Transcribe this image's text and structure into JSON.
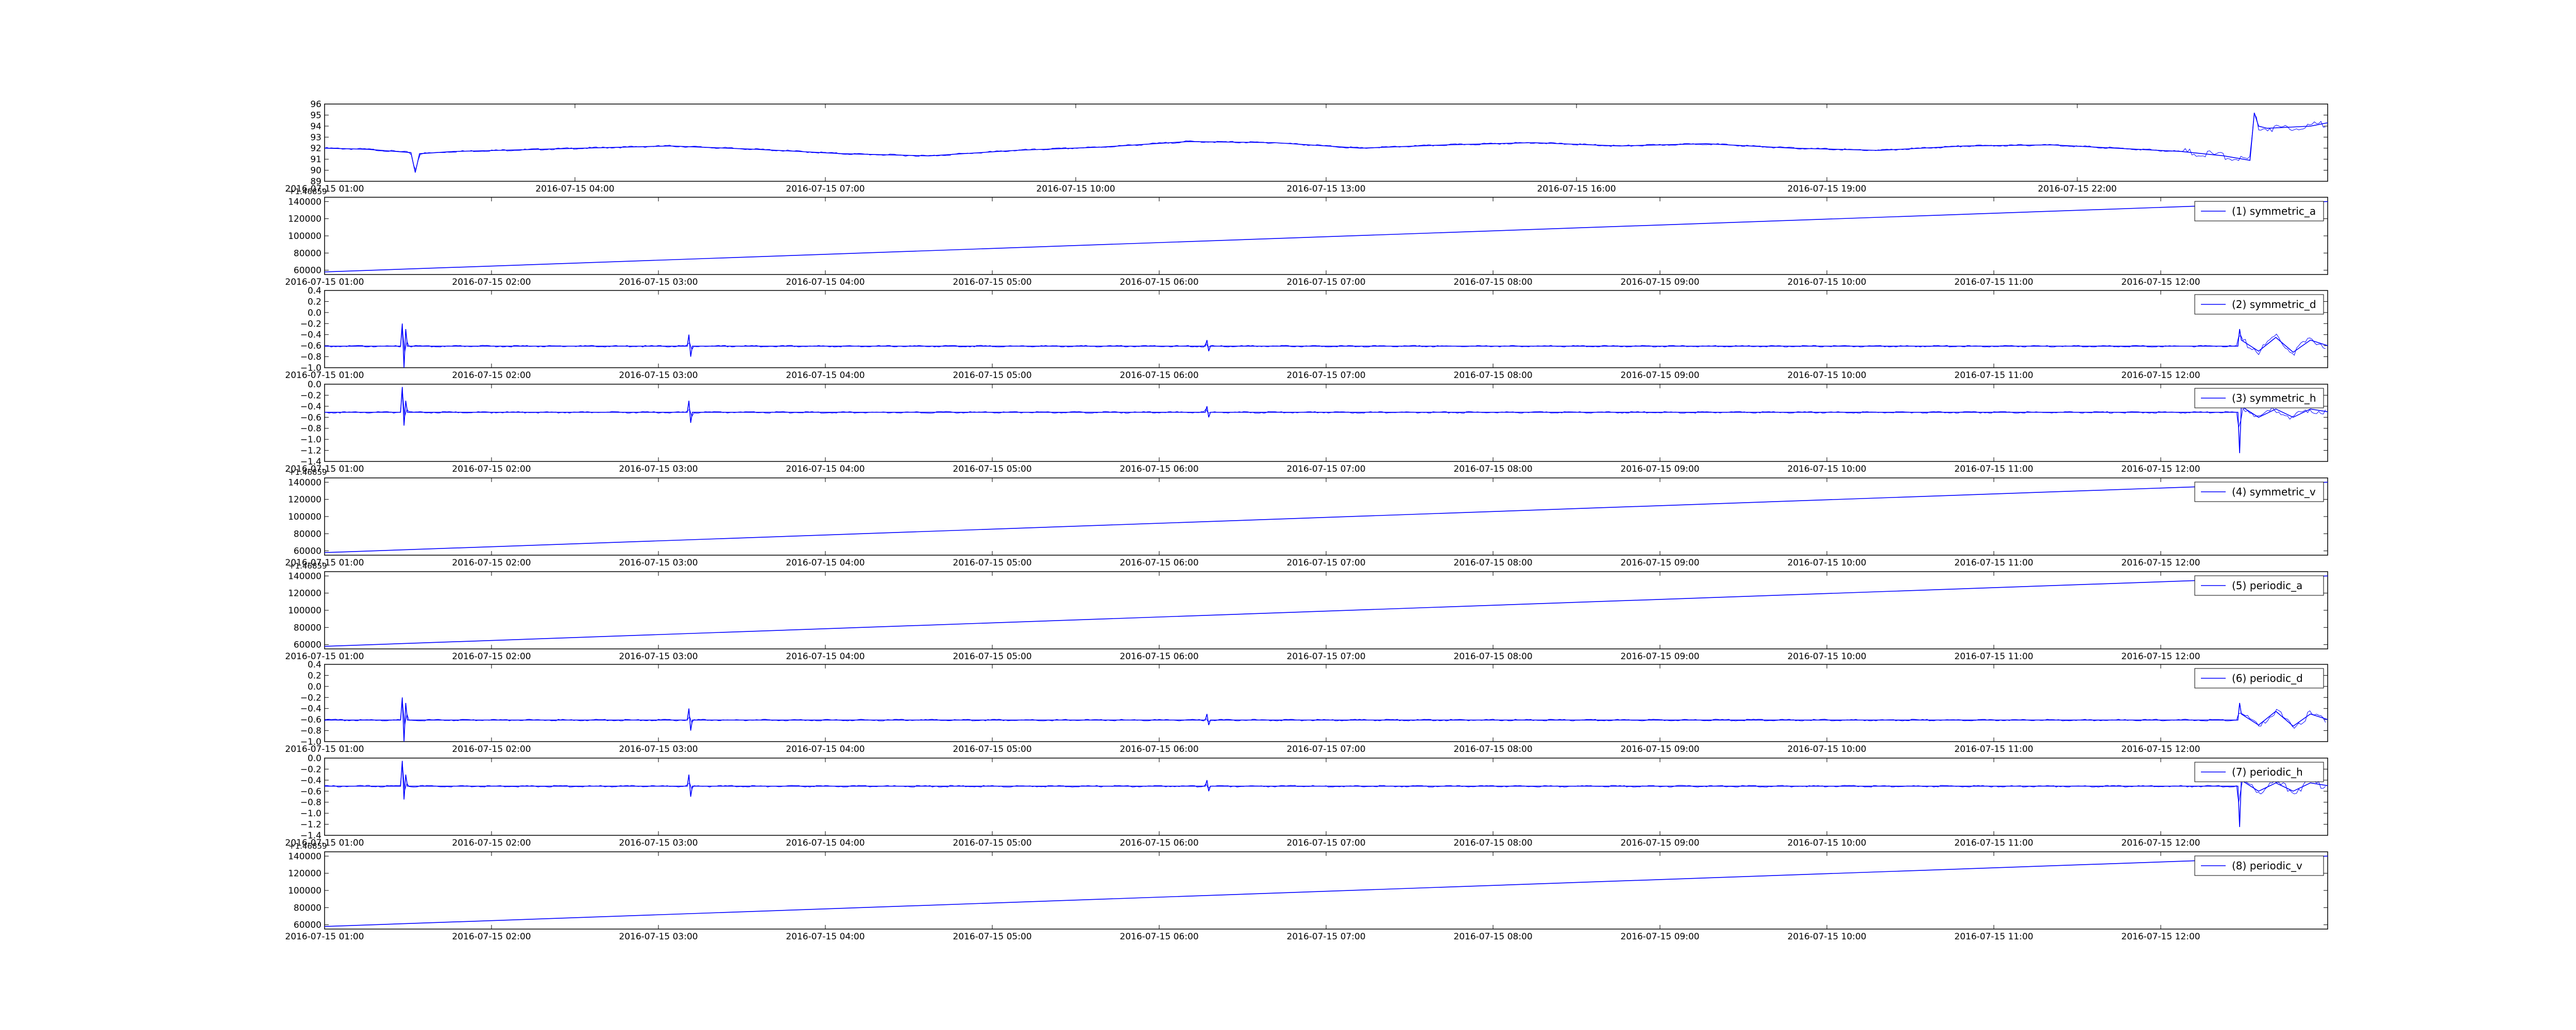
{
  "chart_data": [
    {
      "type": "line",
      "title": "",
      "xlabel": "",
      "ylabel": "",
      "x_ticks": [
        "2016-07-15 01:00",
        "2016-07-15 04:00",
        "2016-07-15 07:00",
        "2016-07-15 10:00",
        "2016-07-15 13:00",
        "2016-07-15 16:00",
        "2016-07-15 19:00",
        "2016-07-15 22:00"
      ],
      "xlim": [
        0,
        23.2
      ],
      "y_ticks": [
        "89",
        "90",
        "91",
        "92",
        "93",
        "94",
        "95",
        "96"
      ],
      "ylim": [
        89,
        96
      ],
      "offset_text": "",
      "legend": "",
      "grid": false,
      "color": "#0000ff",
      "series": [
        {
          "x": [
            0,
            0.5,
            1.0,
            1.05,
            1.1,
            1.5,
            2,
            3,
            4,
            5,
            6,
            7,
            8,
            9,
            10,
            11,
            12,
            13,
            14,
            15,
            16,
            17,
            18,
            19,
            20,
            21,
            21.5,
            22,
            22.3,
            22.35,
            22.4,
            22.5,
            23,
            23.2
          ],
          "y": [
            92.0,
            91.9,
            91.6,
            89.8,
            91.5,
            91.7,
            91.8,
            92.0,
            92.2,
            91.9,
            91.5,
            91.3,
            91.8,
            92.1,
            92.6,
            92.5,
            92.0,
            92.3,
            92.5,
            92.2,
            92.4,
            92.0,
            91.8,
            92.2,
            92.3,
            91.9,
            91.7,
            91.3,
            90.9,
            95.2,
            94.0,
            93.8,
            94.0,
            94.3
          ]
        }
      ]
    },
    {
      "type": "line",
      "title": "",
      "xlabel": "",
      "ylabel": "",
      "x_ticks": [
        "2016-07-15 01:00",
        "2016-07-15 02:00",
        "2016-07-15 03:00",
        "2016-07-15 04:00",
        "2016-07-15 05:00",
        "2016-07-15 06:00",
        "2016-07-15 07:00",
        "2016-07-15 08:00",
        "2016-07-15 09:00",
        "2016-07-15 10:00",
        "2016-07-15 11:00",
        "2016-07-15 12:00"
      ],
      "xlim": [
        0,
        11.6
      ],
      "y_ticks": [
        "60000",
        "80000",
        "100000",
        "120000",
        "140000"
      ],
      "ylim": [
        55000,
        145000
      ],
      "offset_text": "+1.46859",
      "legend": "top-right",
      "grid": false,
      "color": "#0000ff",
      "series": [
        {
          "name": "(1) symmetric_a",
          "x": [
            0,
            11.6
          ],
          "y": [
            58000,
            140000
          ]
        }
      ]
    },
    {
      "type": "line",
      "title": "",
      "xlabel": "",
      "ylabel": "",
      "x_ticks": [
        "2016-07-15 01:00",
        "2016-07-15 02:00",
        "2016-07-15 03:00",
        "2016-07-15 04:00",
        "2016-07-15 05:00",
        "2016-07-15 06:00",
        "2016-07-15 07:00",
        "2016-07-15 08:00",
        "2016-07-15 09:00",
        "2016-07-15 10:00",
        "2016-07-15 11:00",
        "2016-07-15 12:00"
      ],
      "xlim": [
        0,
        11.6
      ],
      "y_ticks": [
        "−1.0",
        "−0.8",
        "−0.6",
        "−0.4",
        "−0.2",
        "0.0",
        "0.2",
        "0.4"
      ],
      "ylim": [
        -1.0,
        0.4
      ],
      "offset_text": "",
      "legend": "top-right",
      "grid": false,
      "color": "#0000ff",
      "series": [
        {
          "name": "(2) symmetric_d",
          "x": [
            0,
            0.44,
            0.45,
            0.46,
            0.47,
            0.48,
            1.5,
            2.1,
            2.11,
            2.12,
            2.13,
            2.14,
            4.5,
            5.1,
            5.11,
            5.12,
            5.13,
            11.08,
            11.09,
            11.1,
            11.2,
            11.3,
            11.4,
            11.5,
            11.6
          ],
          "y": [
            -0.61,
            -0.61,
            -0.2,
            -1.0,
            -0.3,
            -0.61,
            -0.61,
            -0.61,
            -0.4,
            -0.8,
            -0.61,
            -0.61,
            -0.61,
            -0.61,
            -0.5,
            -0.7,
            -0.61,
            -0.61,
            -0.3,
            -0.5,
            -0.7,
            -0.45,
            -0.72,
            -0.5,
            -0.6
          ]
        }
      ]
    },
    {
      "type": "line",
      "title": "",
      "xlabel": "",
      "ylabel": "",
      "x_ticks": [
        "2016-07-15 01:00",
        "2016-07-15 02:00",
        "2016-07-15 03:00",
        "2016-07-15 04:00",
        "2016-07-15 05:00",
        "2016-07-15 06:00",
        "2016-07-15 07:00",
        "2016-07-15 08:00",
        "2016-07-15 09:00",
        "2016-07-15 10:00",
        "2016-07-15 11:00",
        "2016-07-15 12:00"
      ],
      "xlim": [
        0,
        11.6
      ],
      "y_ticks": [
        "−1.4",
        "−1.2",
        "−1.0",
        "−0.8",
        "−0.6",
        "−0.4",
        "−0.2",
        "0.0"
      ],
      "ylim": [
        -1.4,
        0.0
      ],
      "offset_text": "",
      "legend": "top-right",
      "grid": false,
      "color": "#0000ff",
      "series": [
        {
          "name": "(3) symmetric_h",
          "x": [
            0,
            0.44,
            0.45,
            0.46,
            0.47,
            0.48,
            1.5,
            2.1,
            2.11,
            2.12,
            2.13,
            2.14,
            4.5,
            5.1,
            5.11,
            5.12,
            5.13,
            11.08,
            11.09,
            11.1,
            11.2,
            11.3,
            11.4,
            11.5,
            11.6
          ],
          "y": [
            -0.51,
            -0.51,
            -0.05,
            -0.75,
            -0.3,
            -0.51,
            -0.51,
            -0.51,
            -0.3,
            -0.7,
            -0.51,
            -0.51,
            -0.51,
            -0.51,
            -0.4,
            -0.6,
            -0.51,
            -0.51,
            -1.25,
            -0.4,
            -0.6,
            -0.45,
            -0.6,
            -0.45,
            -0.5
          ]
        }
      ]
    },
    {
      "type": "line",
      "title": "",
      "xlabel": "",
      "ylabel": "",
      "x_ticks": [
        "2016-07-15 01:00",
        "2016-07-15 02:00",
        "2016-07-15 03:00",
        "2016-07-15 04:00",
        "2016-07-15 05:00",
        "2016-07-15 06:00",
        "2016-07-15 07:00",
        "2016-07-15 08:00",
        "2016-07-15 09:00",
        "2016-07-15 10:00",
        "2016-07-15 11:00",
        "2016-07-15 12:00"
      ],
      "xlim": [
        0,
        11.6
      ],
      "y_ticks": [
        "60000",
        "80000",
        "100000",
        "120000",
        "140000"
      ],
      "ylim": [
        55000,
        145000
      ],
      "offset_text": "+1.46859",
      "legend": "top-right",
      "grid": false,
      "color": "#0000ff",
      "series": [
        {
          "name": "(4) symmetric_v",
          "x": [
            0,
            11.6
          ],
          "y": [
            58000,
            140000
          ]
        }
      ]
    },
    {
      "type": "line",
      "title": "",
      "xlabel": "",
      "ylabel": "",
      "x_ticks": [
        "2016-07-15 01:00",
        "2016-07-15 02:00",
        "2016-07-15 03:00",
        "2016-07-15 04:00",
        "2016-07-15 05:00",
        "2016-07-15 06:00",
        "2016-07-15 07:00",
        "2016-07-15 08:00",
        "2016-07-15 09:00",
        "2016-07-15 10:00",
        "2016-07-15 11:00",
        "2016-07-15 12:00"
      ],
      "xlim": [
        0,
        11.6
      ],
      "y_ticks": [
        "60000",
        "80000",
        "100000",
        "120000",
        "140000"
      ],
      "ylim": [
        55000,
        145000
      ],
      "offset_text": "+1.46859",
      "legend": "top-right",
      "grid": false,
      "color": "#0000ff",
      "series": [
        {
          "name": "(5) periodic_a",
          "x": [
            0,
            11.6
          ],
          "y": [
            58000,
            140000
          ]
        }
      ]
    },
    {
      "type": "line",
      "title": "",
      "xlabel": "",
      "ylabel": "",
      "x_ticks": [
        "2016-07-15 01:00",
        "2016-07-15 02:00",
        "2016-07-15 03:00",
        "2016-07-15 04:00",
        "2016-07-15 05:00",
        "2016-07-15 06:00",
        "2016-07-15 07:00",
        "2016-07-15 08:00",
        "2016-07-15 09:00",
        "2016-07-15 10:00",
        "2016-07-15 11:00",
        "2016-07-15 12:00"
      ],
      "xlim": [
        0,
        11.6
      ],
      "y_ticks": [
        "−1.0",
        "−0.8",
        "−0.6",
        "−0.4",
        "−0.2",
        "0.0",
        "0.2",
        "0.4"
      ],
      "ylim": [
        -1.0,
        0.4
      ],
      "offset_text": "",
      "legend": "top-right",
      "grid": false,
      "color": "#0000ff",
      "series": [
        {
          "name": "(6) periodic_d",
          "x": [
            0,
            0.44,
            0.45,
            0.46,
            0.47,
            0.48,
            1.5,
            2.1,
            2.11,
            2.12,
            2.13,
            2.14,
            4.5,
            5.1,
            5.11,
            5.12,
            5.13,
            11.08,
            11.09,
            11.1,
            11.2,
            11.3,
            11.4,
            11.5,
            11.6
          ],
          "y": [
            -0.61,
            -0.61,
            -0.2,
            -1.0,
            -0.3,
            -0.61,
            -0.61,
            -0.61,
            -0.4,
            -0.8,
            -0.61,
            -0.61,
            -0.61,
            -0.61,
            -0.5,
            -0.7,
            -0.61,
            -0.61,
            -0.3,
            -0.5,
            -0.7,
            -0.45,
            -0.72,
            -0.5,
            -0.6
          ]
        }
      ]
    },
    {
      "type": "line",
      "title": "",
      "xlabel": "",
      "ylabel": "",
      "x_ticks": [
        "2016-07-15 01:00",
        "2016-07-15 02:00",
        "2016-07-15 03:00",
        "2016-07-15 04:00",
        "2016-07-15 05:00",
        "2016-07-15 06:00",
        "2016-07-15 07:00",
        "2016-07-15 08:00",
        "2016-07-15 09:00",
        "2016-07-15 10:00",
        "2016-07-15 11:00",
        "2016-07-15 12:00"
      ],
      "xlim": [
        0,
        11.6
      ],
      "y_ticks": [
        "−1.4",
        "−1.2",
        "−1.0",
        "−0.8",
        "−0.6",
        "−0.4",
        "−0.2",
        "0.0"
      ],
      "ylim": [
        -1.4,
        0.0
      ],
      "offset_text": "",
      "legend": "top-right",
      "grid": false,
      "color": "#0000ff",
      "series": [
        {
          "name": "(7) periodic_h",
          "x": [
            0,
            0.44,
            0.45,
            0.46,
            0.47,
            0.48,
            1.5,
            2.1,
            2.11,
            2.12,
            2.13,
            2.14,
            4.5,
            5.1,
            5.11,
            5.12,
            5.13,
            11.08,
            11.09,
            11.1,
            11.2,
            11.3,
            11.4,
            11.5,
            11.6
          ],
          "y": [
            -0.51,
            -0.51,
            -0.05,
            -0.75,
            -0.3,
            -0.51,
            -0.51,
            -0.51,
            -0.3,
            -0.7,
            -0.51,
            -0.51,
            -0.51,
            -0.51,
            -0.4,
            -0.6,
            -0.51,
            -0.51,
            -1.25,
            -0.4,
            -0.6,
            -0.45,
            -0.6,
            -0.45,
            -0.5
          ]
        }
      ]
    },
    {
      "type": "line",
      "title": "",
      "xlabel": "",
      "ylabel": "",
      "x_ticks": [
        "2016-07-15 01:00",
        "2016-07-15 02:00",
        "2016-07-15 03:00",
        "2016-07-15 04:00",
        "2016-07-15 05:00",
        "2016-07-15 06:00",
        "2016-07-15 07:00",
        "2016-07-15 08:00",
        "2016-07-15 09:00",
        "2016-07-15 10:00",
        "2016-07-15 11:00",
        "2016-07-15 12:00"
      ],
      "xlim": [
        0,
        11.6
      ],
      "y_ticks": [
        "60000",
        "80000",
        "100000",
        "120000",
        "140000"
      ],
      "ylim": [
        55000,
        145000
      ],
      "offset_text": "+1.46859",
      "legend": "top-right",
      "grid": false,
      "color": "#0000ff",
      "series": [
        {
          "name": "(8) periodic_v",
          "x": [
            0,
            11.6
          ],
          "y": [
            58000,
            140000
          ]
        }
      ]
    }
  ]
}
